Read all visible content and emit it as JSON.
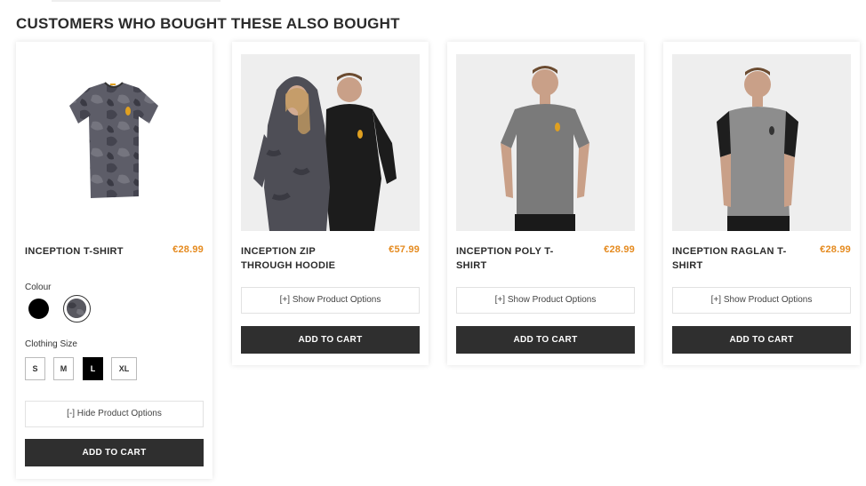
{
  "section": {
    "title": "CUSTOMERS WHO BOUGHT THESE ALSO BOUGHT"
  },
  "products": [
    {
      "name": "INCEPTION T-SHIRT",
      "price": "€28.99",
      "colour_label": "Colour",
      "colours": [
        "black",
        "camo-grey"
      ],
      "size_label": "Clothing Size",
      "sizes": [
        "S",
        "M",
        "L",
        "XL"
      ],
      "selected_size": "L",
      "options_label": "[-] Hide Product Options",
      "cart_label": "ADD TO CART"
    },
    {
      "name": "INCEPTION ZIP THROUGH HOODIE",
      "price": "€57.99",
      "options_label": "[+] Show Product Options",
      "cart_label": "ADD TO CART"
    },
    {
      "name": "INCEPTION POLY T-SHIRT",
      "price": "€28.99",
      "options_label": "[+] Show Product Options",
      "cart_label": "ADD TO CART"
    },
    {
      "name": "INCEPTION RAGLAN T-SHIRT",
      "price": "€28.99",
      "options_label": "[+] Show Product Options",
      "cart_label": "ADD TO CART"
    }
  ],
  "colors": {
    "price": "#e58b20",
    "button_dark": "#2f2f2f",
    "accent_logo": "#e0a020"
  }
}
